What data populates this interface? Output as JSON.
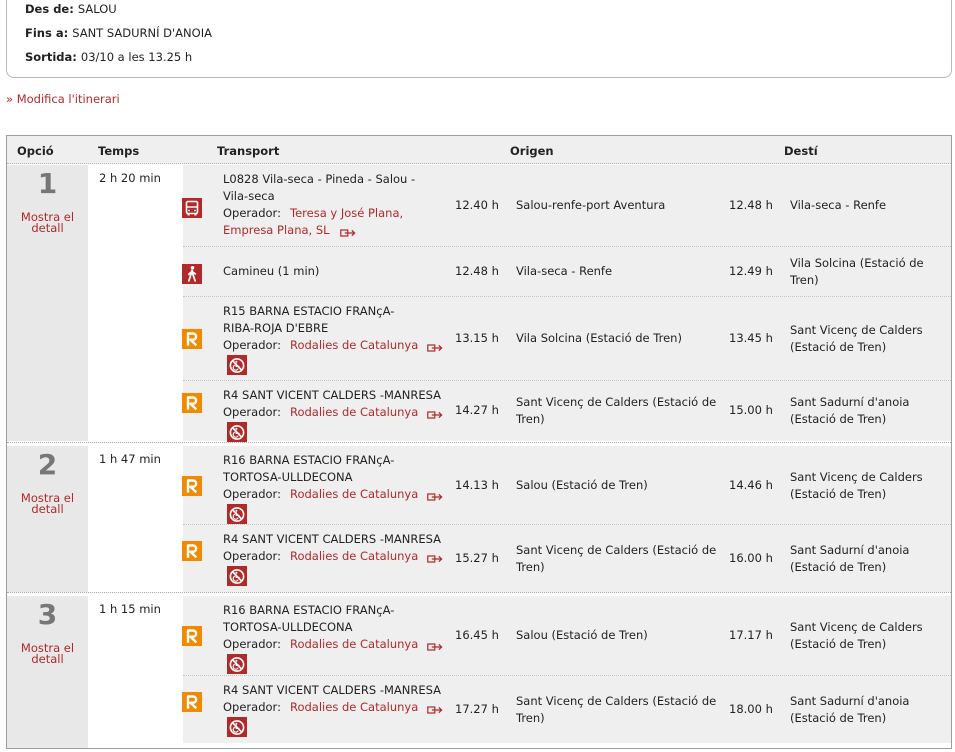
{
  "summary": {
    "from_label": "Des de:",
    "from_value": "SALOU",
    "to_label": "Fins a:",
    "to_value": "SANT SADURNÍ D'ANOIA",
    "dep_label": "Sortida:",
    "dep_value": "03/10 a les 13.25 h"
  },
  "modify_link": "» Modifica l'itinerari",
  "headers": {
    "option": "Opció",
    "time": "Temps",
    "transport": "Transport",
    "origin": "Origen",
    "dest": "Destí"
  },
  "operator_label": "Operador:",
  "detail_label": "Mostra el detall",
  "colors": {
    "accent_red": "#b02a2a",
    "rodalies_orange": "#f08a00",
    "header_bg": "#efefef"
  },
  "options": [
    {
      "number": "1",
      "duration": "2 h 20 min",
      "segments": [
        {
          "icon": "bus-icon",
          "line1": "L0828 Vila-seca - Pineda - Salou -",
          "line2": "Vila-seca",
          "op1": "Teresa y José Plana,",
          "op2": "Empresa Plana, SL",
          "dep": "12.40 h",
          "origin": "Salou-renfe-port Aventura",
          "arr": "12.48 h",
          "dest": "Vila-seca - Renfe"
        },
        {
          "icon": "walk-icon",
          "line1": "Camineu (1 min)",
          "dep": "12.48 h",
          "origin": "Vila-seca - Renfe",
          "arr": "12.49 h",
          "dest1": "Vila Solcina (Estació de",
          "dest2": "Tren)"
        },
        {
          "icon": "rodalies-icon",
          "line1": "R15 BARNA ESTACIO FRANçA-",
          "line2": "RIBA-ROJA D'EBRE",
          "op1": "Rodalies de Catalunya",
          "dep": "13.15 h",
          "origin": "Vila Solcina (Estació de Tren)",
          "arr": "13.45 h",
          "dest1": "Sant Vicenç de Calders",
          "dest2": "(Estació de Tren)"
        },
        {
          "icon": "rodalies-icon",
          "line1": "R4 SANT VICENT CALDERS -MANRESA",
          "op1": "Rodalies de Catalunya",
          "dep": "14.27 h",
          "origin1": "Sant Vicenç de Calders (Estació de",
          "origin2": "Tren)",
          "arr": "15.00 h",
          "dest1": "Sant Sadurní d'anoia",
          "dest2": "(Estació de Tren)"
        }
      ]
    },
    {
      "number": "2",
      "duration": "1 h 47 min",
      "segments": [
        {
          "icon": "rodalies-icon",
          "line1": "R16 BARNA ESTACIO FRANçA-",
          "line2": "TORTOSA-ULLDECONA",
          "op1": "Rodalies de Catalunya",
          "dep": "14.13 h",
          "origin": "Salou (Estació de Tren)",
          "arr": "14.46 h",
          "dest1": "Sant Vicenç de Calders",
          "dest2": "(Estació de Tren)"
        },
        {
          "icon": "rodalies-icon",
          "line1": "R4 SANT VICENT CALDERS -MANRESA",
          "op1": "Rodalies de Catalunya",
          "dep": "15.27 h",
          "origin1": "Sant Vicenç de Calders (Estació de",
          "origin2": "Tren)",
          "arr": "16.00 h",
          "dest1": "Sant Sadurní d'anoia",
          "dest2": "(Estació de Tren)"
        }
      ]
    },
    {
      "number": "3",
      "duration": "1 h 15 min",
      "segments": [
        {
          "icon": "rodalies-icon",
          "line1": "R16 BARNA ESTACIO FRANçA-",
          "line2": "TORTOSA-ULLDECONA",
          "op1": "Rodalies de Catalunya",
          "dep": "16.45 h",
          "origin": "Salou (Estació de Tren)",
          "arr": "17.17 h",
          "dest1": "Sant Vicenç de Calders",
          "dest2": "(Estació de Tren)"
        },
        {
          "icon": "rodalies-icon",
          "line1": "R4 SANT VICENT CALDERS -MANRESA",
          "op1": "Rodalies de Catalunya",
          "dep": "17.27 h",
          "origin1": "Sant Vicenç de Calders (Estació de",
          "origin2": "Tren)",
          "arr": "18.00 h",
          "dest1": "Sant Sadurní d'anoia",
          "dest2": "(Estació de Tren)"
        }
      ]
    }
  ]
}
